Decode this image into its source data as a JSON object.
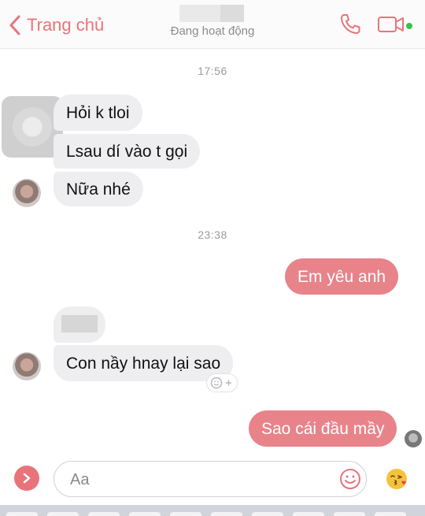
{
  "header": {
    "back_label": "Trang chủ",
    "status": "Đang hoạt động"
  },
  "messages": {
    "time_1": "17:56",
    "in_1": "Hỏi k tloi",
    "in_2": "Lsau dí vào t gọi",
    "in_3": "Nữa nhé",
    "time_2": "23:38",
    "out_1": "Em yêu anh",
    "in_4": "Con nầy hnay lại sao",
    "out_2": "Sao cái đầu mầy"
  },
  "composer": {
    "placeholder": "Aa"
  },
  "colors": {
    "accent": "#e8838a",
    "online": "#3cc14c"
  }
}
